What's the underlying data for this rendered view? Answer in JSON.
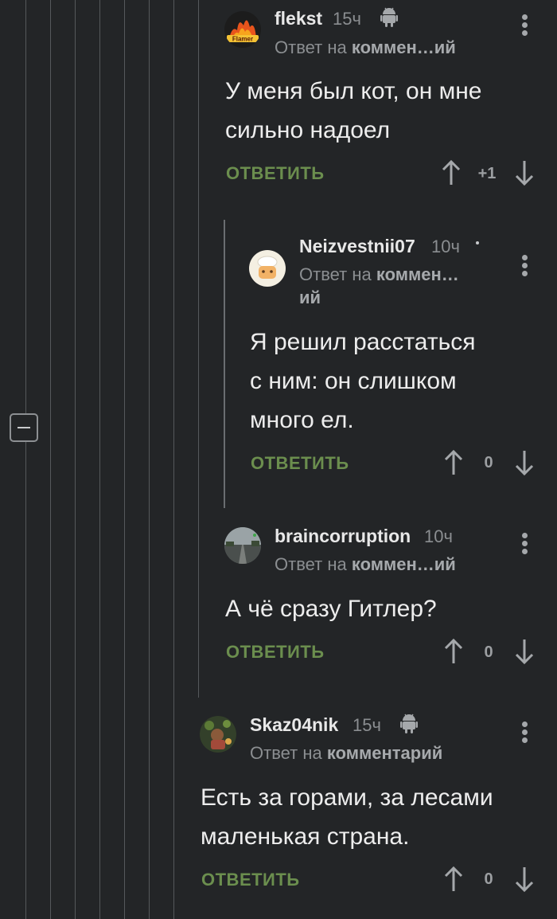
{
  "icons": {
    "platform": "android-icon",
    "options": "more-vertical-icon",
    "upvote": "arrow-up-icon",
    "downvote": "arrow-down-icon",
    "collapse": "minus-square-icon"
  },
  "colors": {
    "background": "#232527",
    "reply_button": "#6b8e4e",
    "thread_line": "#55585b"
  },
  "comments": [
    {
      "username": "flekst",
      "time": "15ч",
      "reply_prefix": "Ответ на",
      "reply_target": "коммен…ий",
      "body_lines": [
        "У меня был кот, он мне",
        "сильно надоел"
      ],
      "reply_label": "ОТВЕТИТЬ",
      "score": "+1"
    },
    {
      "username": "Neizvestnii07",
      "time": "10ч",
      "reply_prefix": "Ответ на",
      "reply_target": "коммен…",
      "reply_target_cont": "ий",
      "body_lines": [
        "Я решил расстаться",
        "с ним: он слишком",
        "много ел."
      ],
      "reply_label": "ОТВЕТИТЬ",
      "score": "0"
    },
    {
      "username": "braincorruption",
      "time": "10ч",
      "reply_prefix": "Ответ на",
      "reply_target": "коммен…ий",
      "body_lines": [
        "А чё сразу Гитлер?"
      ],
      "reply_label": "ОТВЕТИТЬ",
      "score": "0"
    },
    {
      "username": "Skaz04nik",
      "time": "15ч",
      "reply_prefix": "Ответ на",
      "reply_target": "комментарий",
      "body_lines": [
        "Есть за горами, за лесами",
        "маленькая страна."
      ],
      "reply_label": "ОТВЕТИТЬ",
      "score": "0"
    }
  ]
}
